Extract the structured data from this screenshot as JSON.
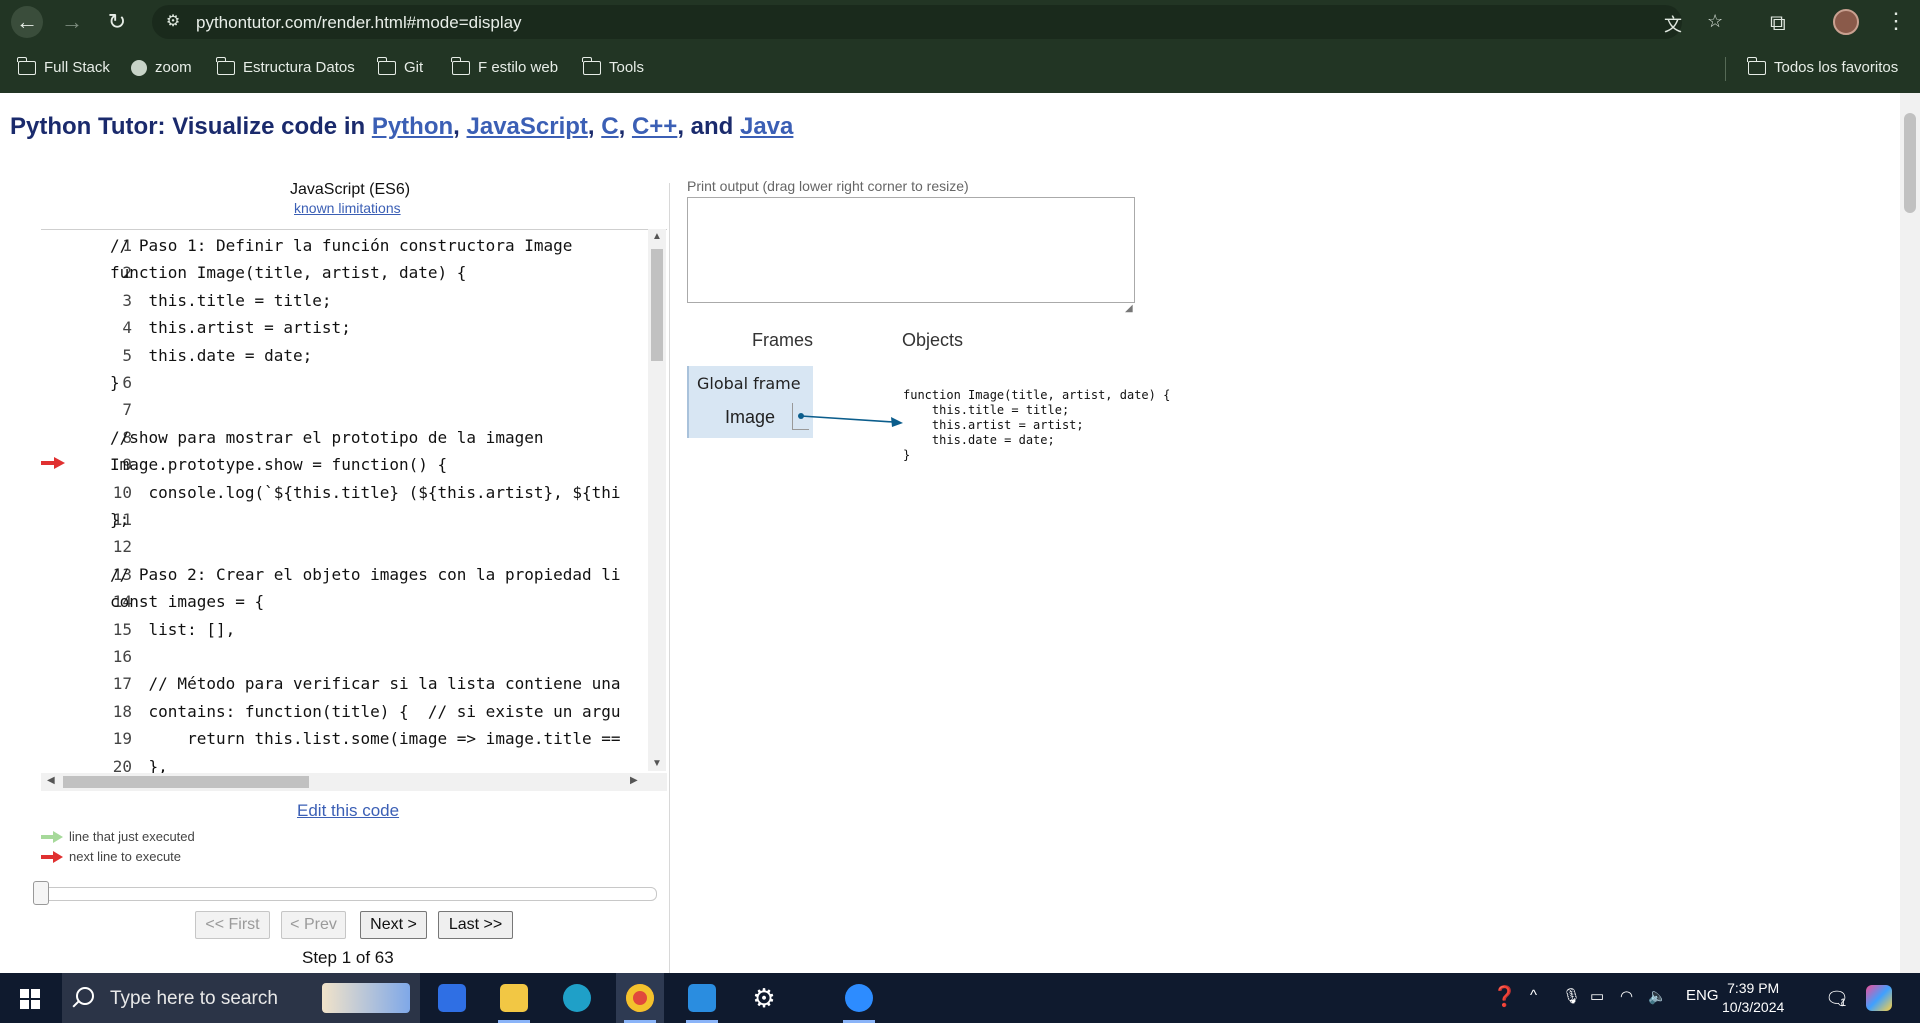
{
  "browser": {
    "url": "pythontutor.com/render.html#mode=display",
    "bookmarks": [
      "Full Stack",
      "zoom",
      "Estructura Datos",
      "Git",
      "F estilo web",
      "Tools"
    ],
    "all_bookmarks": "Todos los favoritos"
  },
  "page": {
    "title_prefix": "Python Tutor: Visualize code in ",
    "lang_python": "Python",
    "lang_js": "JavaScript",
    "lang_c": "C",
    "lang_cpp": "C++",
    "lang_java": "Java",
    "sep1": ", ",
    "sep2": ", ",
    "sep3": ", ",
    "and": ", and ",
    "language": "JavaScript (ES6)",
    "known_limitations": "known limitations",
    "code_lines": [
      {
        "n": "1",
        "text": "// Paso 1: Definir la función constructora Image"
      },
      {
        "n": "2",
        "text": "function Image(title, artist, date) {"
      },
      {
        "n": "3",
        "text": "    this.title = title;"
      },
      {
        "n": "4",
        "text": "    this.artist = artist;"
      },
      {
        "n": "5",
        "text": "    this.date = date;"
      },
      {
        "n": "6",
        "text": "}"
      },
      {
        "n": "7",
        "text": ""
      },
      {
        "n": "8",
        "text": "//show para mostrar el prototipo de la imagen"
      },
      {
        "n": "9",
        "text": "Image.prototype.show = function() {"
      },
      {
        "n": "10",
        "text": "    console.log(`${this.title} (${this.artist}, ${thi"
      },
      {
        "n": "11",
        "text": "};"
      },
      {
        "n": "12",
        "text": ""
      },
      {
        "n": "13",
        "text": "// Paso 2: Crear el objeto images con la propiedad li"
      },
      {
        "n": "14",
        "text": "const images = {"
      },
      {
        "n": "15",
        "text": "    list: [],"
      },
      {
        "n": "16",
        "text": ""
      },
      {
        "n": "17",
        "text": "    // Método para verificar si la lista contiene una"
      },
      {
        "n": "18",
        "text": "    contains: function(title) {  // si existe un argu"
      },
      {
        "n": "19",
        "text": "        return this.list.some(image => image.title =="
      },
      {
        "n": "20",
        "text": "    },"
      }
    ],
    "next_line": "9",
    "edit_code": "Edit this code",
    "legend_executed": "line that just executed",
    "legend_next": "next line to execute",
    "btn_first": "<< First",
    "btn_prev": "< Prev",
    "btn_next": "Next >",
    "btn_last": "Last >>",
    "step": "Step 1 of 63",
    "print_output_label": "Print output (drag lower right corner to resize)",
    "frames_heading": "Frames",
    "objects_heading": "Objects",
    "global_frame": "Global frame",
    "frame_var": "Image",
    "function_object": "function Image(title, artist, date) {\n    this.title = title;\n    this.artist = artist;\n    this.date = date;\n}"
  },
  "taskbar": {
    "search_placeholder": "Type here to search",
    "lang": "ENG",
    "time": "7:39 PM",
    "date": "10/3/2024",
    "notif_count": "1"
  },
  "colors": {
    "chrome": "#223524",
    "title": "#1a2a6c",
    "link": "#3b5fb5",
    "red_arrow": "#e03030",
    "green_arrow": "#a6d99a",
    "frame_bg": "#d8e6f3",
    "pointer": "#0b5d8c"
  }
}
